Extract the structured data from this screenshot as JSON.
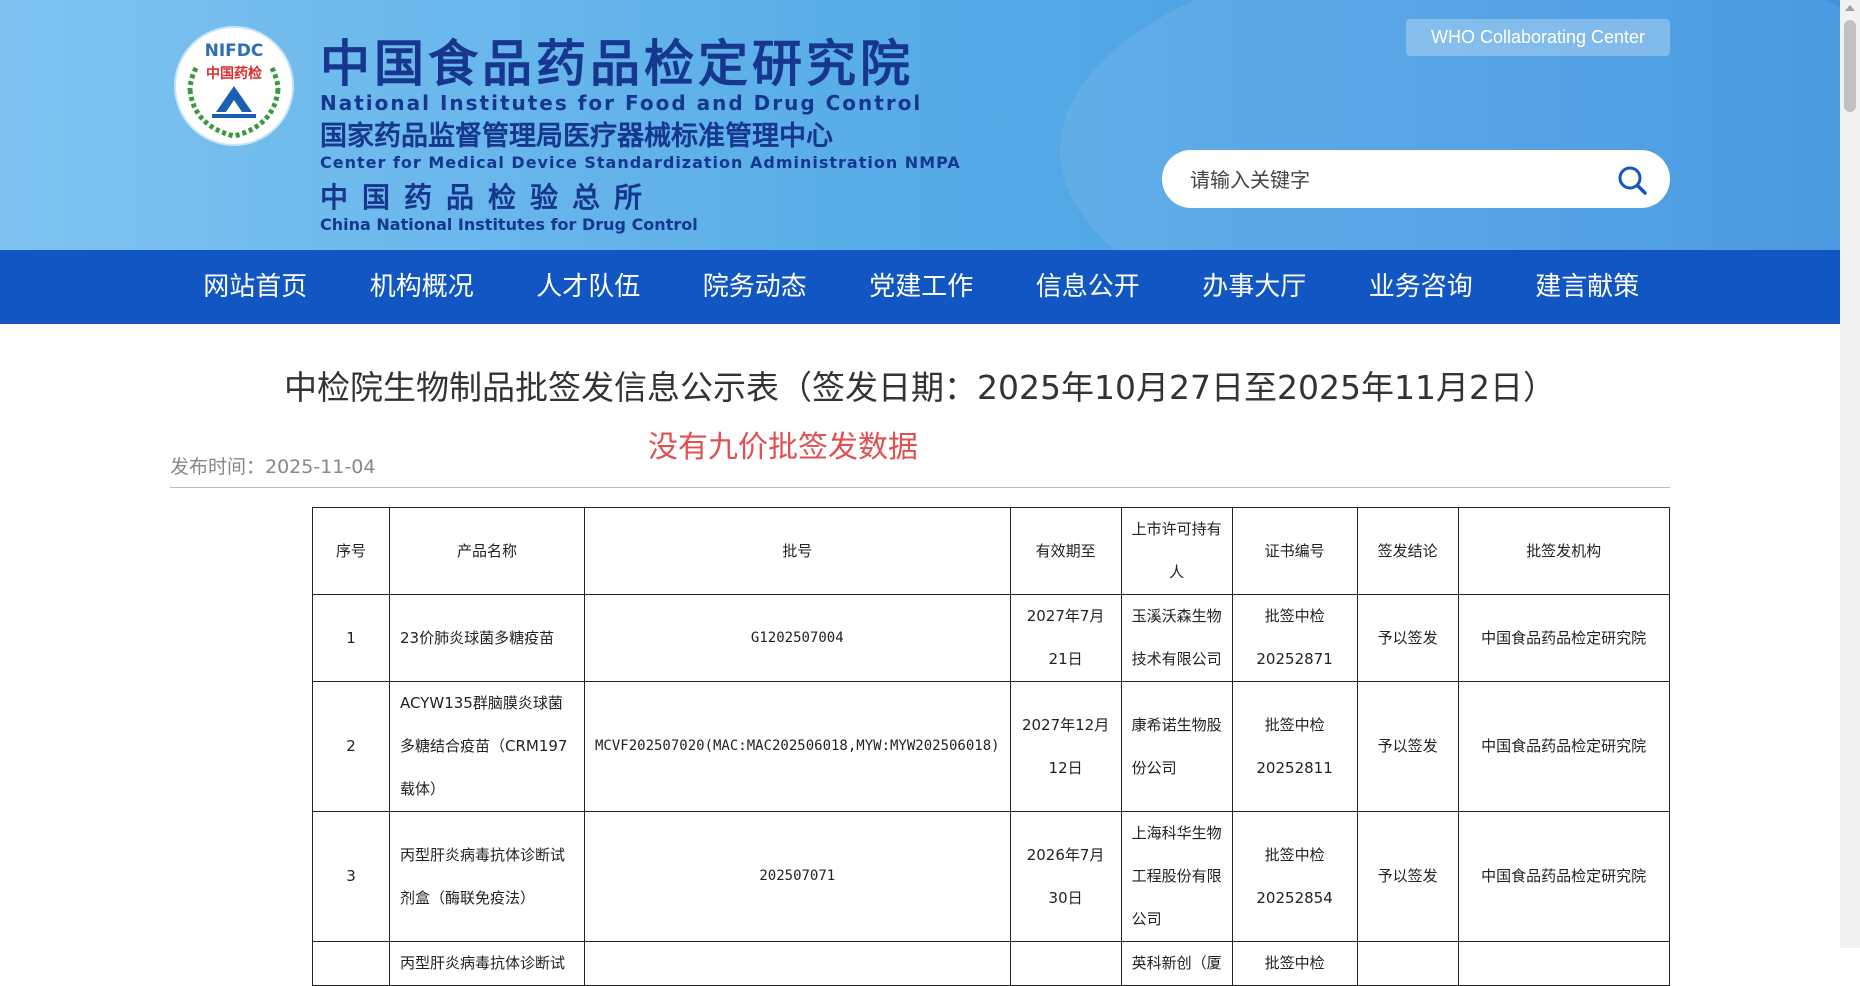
{
  "header": {
    "logo_text_top": "NIFDC",
    "logo_text_mid": "中国药检",
    "title_cn": "中国食品药品检定研究院",
    "title_en": "National Institutes for Food and Drug Control",
    "subtitle_cn": "国家药品监督管理局医疗器械标准管理中心",
    "subtitle_en": "Center for Medical Device Standardization Administration NMPA",
    "third_cn": "中国药品检验总所",
    "third_en": "China National Institutes for Drug Control",
    "who_label": "WHO Collaborating Center",
    "search_placeholder": "请输入关键字"
  },
  "nav": {
    "items": [
      "网站首页",
      "机构概况",
      "人才队伍",
      "院务动态",
      "党建工作",
      "信息公开",
      "办事大厅",
      "业务咨询",
      "建言献策"
    ]
  },
  "article": {
    "title": "中检院生物制品批签发信息公示表（签发日期：2025年10月27日至2025年11月2日）",
    "note": "没有九价批签发数据",
    "publish_time": "发布时间：2025-11-04"
  },
  "table": {
    "headers": [
      "序号",
      "产品名称",
      "批号",
      "有效期至",
      "上市许可持有人",
      "证书编号",
      "签发结论",
      "批签发机构"
    ],
    "rows": [
      [
        "1",
        "23价肺炎球菌多糖疫苗",
        "G1202507004",
        "2027年7月21日",
        "玉溪沃森生物技术有限公司",
        "批签中检20252871",
        "予以签发",
        "中国食品药品检定研究院"
      ],
      [
        "2",
        "ACYW135群脑膜炎球菌多糖结合疫苗（CRM197载体）",
        "MCVF202507020(MAC:MAC202506018,MYW:MYW202506018)",
        "2027年12月12日",
        "康希诺生物股份公司",
        "批签中检20252811",
        "予以签发",
        "中国食品药品检定研究院"
      ],
      [
        "3",
        "丙型肝炎病毒抗体诊断试剂盒（酶联免疫法）",
        "202507071",
        "2026年7月30日",
        "上海科华生物工程股份有限公司",
        "批签中检20252854",
        "予以签发",
        "中国食品药品检定研究院"
      ],
      [
        "",
        "丙型肝炎病毒抗体诊断试",
        "",
        "",
        "英科新创（厦",
        "批签中检",
        "",
        ""
      ]
    ]
  },
  "colors": {
    "nav_bg": "#1256c4",
    "title_blue": "#16378d",
    "note_red": "#e05050"
  }
}
